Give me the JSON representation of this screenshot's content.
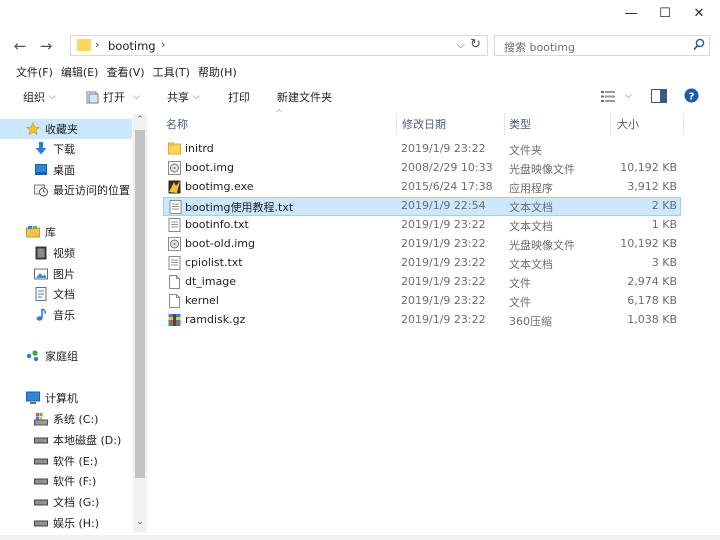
{
  "window": {
    "minimize": "—",
    "maximize": "☐",
    "close": "✕"
  },
  "address": {
    "crumb": "bootimg",
    "sep": "›",
    "dropdown": "⌵",
    "refresh": "↻"
  },
  "nav": {
    "back": "←",
    "forward": "→"
  },
  "search": {
    "placeholder": "搜索 bootimg"
  },
  "menu": [
    "文件(F)",
    "编辑(E)",
    "查看(V)",
    "工具(T)",
    "帮助(H)"
  ],
  "toolbar": {
    "organize": "组织",
    "open": "打开",
    "share": "共享",
    "print": "打印",
    "new_folder": "新建文件夹"
  },
  "sidebar": {
    "items": [
      {
        "label": "收藏夹",
        "icon": "star-icon",
        "selected": true
      },
      {
        "label": "下载",
        "icon": "download-icon"
      },
      {
        "label": "桌面",
        "icon": "desktop-icon"
      },
      {
        "label": "最近访问的位置",
        "icon": "recent-places-icon"
      },
      {
        "label": "库",
        "icon": "library-icon"
      },
      {
        "label": "视频",
        "icon": "video-icon"
      },
      {
        "label": "图片",
        "icon": "pictures-icon"
      },
      {
        "label": "文档",
        "icon": "documents-icon"
      },
      {
        "label": "音乐",
        "icon": "music-icon"
      },
      {
        "label": "家庭组",
        "icon": "homegroup-icon"
      },
      {
        "label": "计算机",
        "icon": "computer-icon"
      },
      {
        "label": "系统 (C:)",
        "icon": "system-drive-icon"
      },
      {
        "label": "本地磁盘 (D:)",
        "icon": "drive-icon"
      },
      {
        "label": "软件 (E:)",
        "icon": "drive-icon"
      },
      {
        "label": "软件 (F:)",
        "icon": "drive-icon"
      },
      {
        "label": "文档 (G:)",
        "icon": "drive-icon"
      },
      {
        "label": "娱乐 (H:)",
        "icon": "drive-icon"
      }
    ]
  },
  "columns": {
    "name": "名称",
    "date": "修改日期",
    "type": "类型",
    "size": "大小"
  },
  "files": [
    {
      "name": "initrd",
      "date": "2019/1/9 23:22",
      "type": "文件夹",
      "size": "",
      "icon": "folder-icon"
    },
    {
      "name": "boot.img",
      "date": "2008/2/29 10:33",
      "type": "光盘映像文件",
      "size": "10,192 KB",
      "icon": "disc-image-icon"
    },
    {
      "name": "bootimg.exe",
      "date": "2015/6/24 17:38",
      "type": "应用程序",
      "size": "3,912 KB",
      "icon": "exe-icon"
    },
    {
      "name": "bootimg使用教程.txt",
      "date": "2019/1/9 22:54",
      "type": "文本文档",
      "size": "2 KB",
      "icon": "text-file-icon",
      "selected": true
    },
    {
      "name": "bootinfo.txt",
      "date": "2019/1/9 23:22",
      "type": "文本文档",
      "size": "1 KB",
      "icon": "text-file-icon"
    },
    {
      "name": "boot-old.img",
      "date": "2019/1/9 23:22",
      "type": "光盘映像文件",
      "size": "10,192 KB",
      "icon": "disc-image-icon"
    },
    {
      "name": "cpiolist.txt",
      "date": "2019/1/9 23:22",
      "type": "文本文档",
      "size": "3 KB",
      "icon": "text-file-icon"
    },
    {
      "name": "dt_image",
      "date": "2019/1/9 23:22",
      "type": "文件",
      "size": "2,974 KB",
      "icon": "file-icon"
    },
    {
      "name": "kernel",
      "date": "2019/1/9 23:22",
      "type": "文件",
      "size": "6,178 KB",
      "icon": "file-icon"
    },
    {
      "name": "ramdisk.gz",
      "date": "2019/1/9 23:22",
      "type": "360压缩",
      "size": "1,038 KB",
      "icon": "archive-icon"
    }
  ]
}
